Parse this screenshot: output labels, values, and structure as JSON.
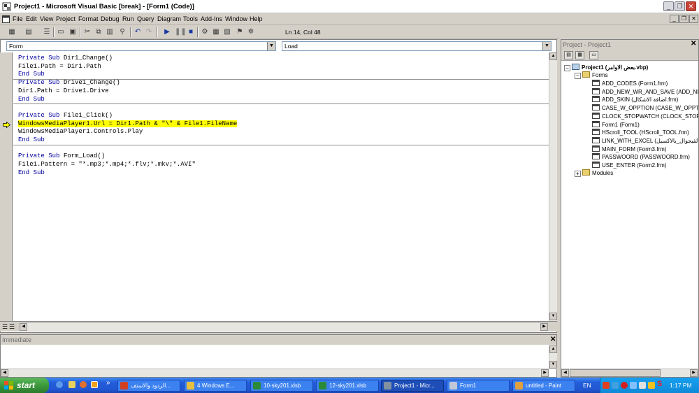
{
  "window": {
    "title": "Project1 - Microsoft Visual Basic [break] - [Form1 (Code)]",
    "controls": [
      "_",
      "❐",
      "✕"
    ]
  },
  "menu": [
    "File",
    "Edit",
    "View",
    "Project",
    "Format",
    "Debug",
    "Run",
    "Query",
    "Diagram",
    "Tools",
    "Add-Ins",
    "Window",
    "Help"
  ],
  "toolbar": {
    "cursor_position": "Ln 14, Col 48"
  },
  "code_window": {
    "object_combo": "Form",
    "procedure_combo": "Load",
    "lines": [
      {
        "kw": "Private Sub ",
        "text": "Dir1_Change()",
        "hl": false
      },
      {
        "kw": "",
        "text": "File1.Path = Dir1.Path",
        "hl": false
      },
      {
        "kw": "End Sub",
        "text": "",
        "hl": false
      },
      {
        "kw": "Private Sub ",
        "text": "Drive1_Change()",
        "hl": false
      },
      {
        "kw": "",
        "text": "Dir1.Path = Drive1.Drive",
        "hl": false
      },
      {
        "kw": "End Sub",
        "text": "",
        "hl": false
      },
      {
        "kw": "",
        "text": "",
        "hl": false
      },
      {
        "kw": "Private Sub ",
        "text": "File1_Click()",
        "hl": false
      },
      {
        "kw": "",
        "text": "WindowsMediaPlayer1.Url = Dir1.Path & \"\\\" & File1.FileName",
        "hl": true
      },
      {
        "kw": "",
        "text": "WindowsMediaPlayer1.Controls.Play",
        "hl": false
      },
      {
        "kw": "End Sub",
        "text": "",
        "hl": false
      },
      {
        "kw": "",
        "text": "",
        "hl": false
      },
      {
        "kw": "Private Sub ",
        "text": "Form_Load()",
        "hl": false
      },
      {
        "kw": "",
        "text": "File1.Pattern = \"*.mp3;*.mp4;*.flv;*.mkv;*.AVI\"",
        "hl": false
      },
      {
        "kw": "End Sub",
        "text": "",
        "hl": false
      }
    ]
  },
  "immediate": {
    "title": "Immediate"
  },
  "project_explorer": {
    "title": "Project - Project1",
    "root": "Project1 (بعض الاوامر.vbp)",
    "forms_folder": "Forms",
    "forms": [
      "ADD_CODES (Form1.frm)",
      "ADD_NEW_WR_AND_SAVE (ADD_NEW",
      "ADD_SKIN (اضافة الاشكال.frm)",
      "CASE_W_OPPTION (CASE_W_OPPTION",
      "CLOCK_STOPWATCH (CLOCK_STOPWA",
      "Form1 (Form1)",
      "HScroll_TOOL (HScroll_TOOL.frm)",
      "LINK_WITH_EXCEL (الفيجوال_بالاكسيل",
      "MAIN_FORM (Form3.frm)",
      "PASSWOORD (PASSWOORD.frm)",
      "USE_ENTER (Form2.frm)"
    ],
    "modules_folder": "Modules"
  },
  "taskbar": {
    "start": "start",
    "tasks": [
      {
        "label": "الردود والاستف...",
        "color": "#d04020"
      },
      {
        "label": "4 Windows E...",
        "color": "#e8c040"
      },
      {
        "label": "10-sky201.xlsb",
        "color": "#2a8a3a"
      },
      {
        "label": "12-sky201.xlsb",
        "color": "#2a8a3a"
      },
      {
        "label": "Project1 - Micr...",
        "color": "#8090a0"
      },
      {
        "label": "Form1",
        "color": "#c0c8d8"
      },
      {
        "label": "untitled - Paint",
        "color": "#e0a040"
      }
    ],
    "language": "EN",
    "clock": "1:17 PM"
  }
}
